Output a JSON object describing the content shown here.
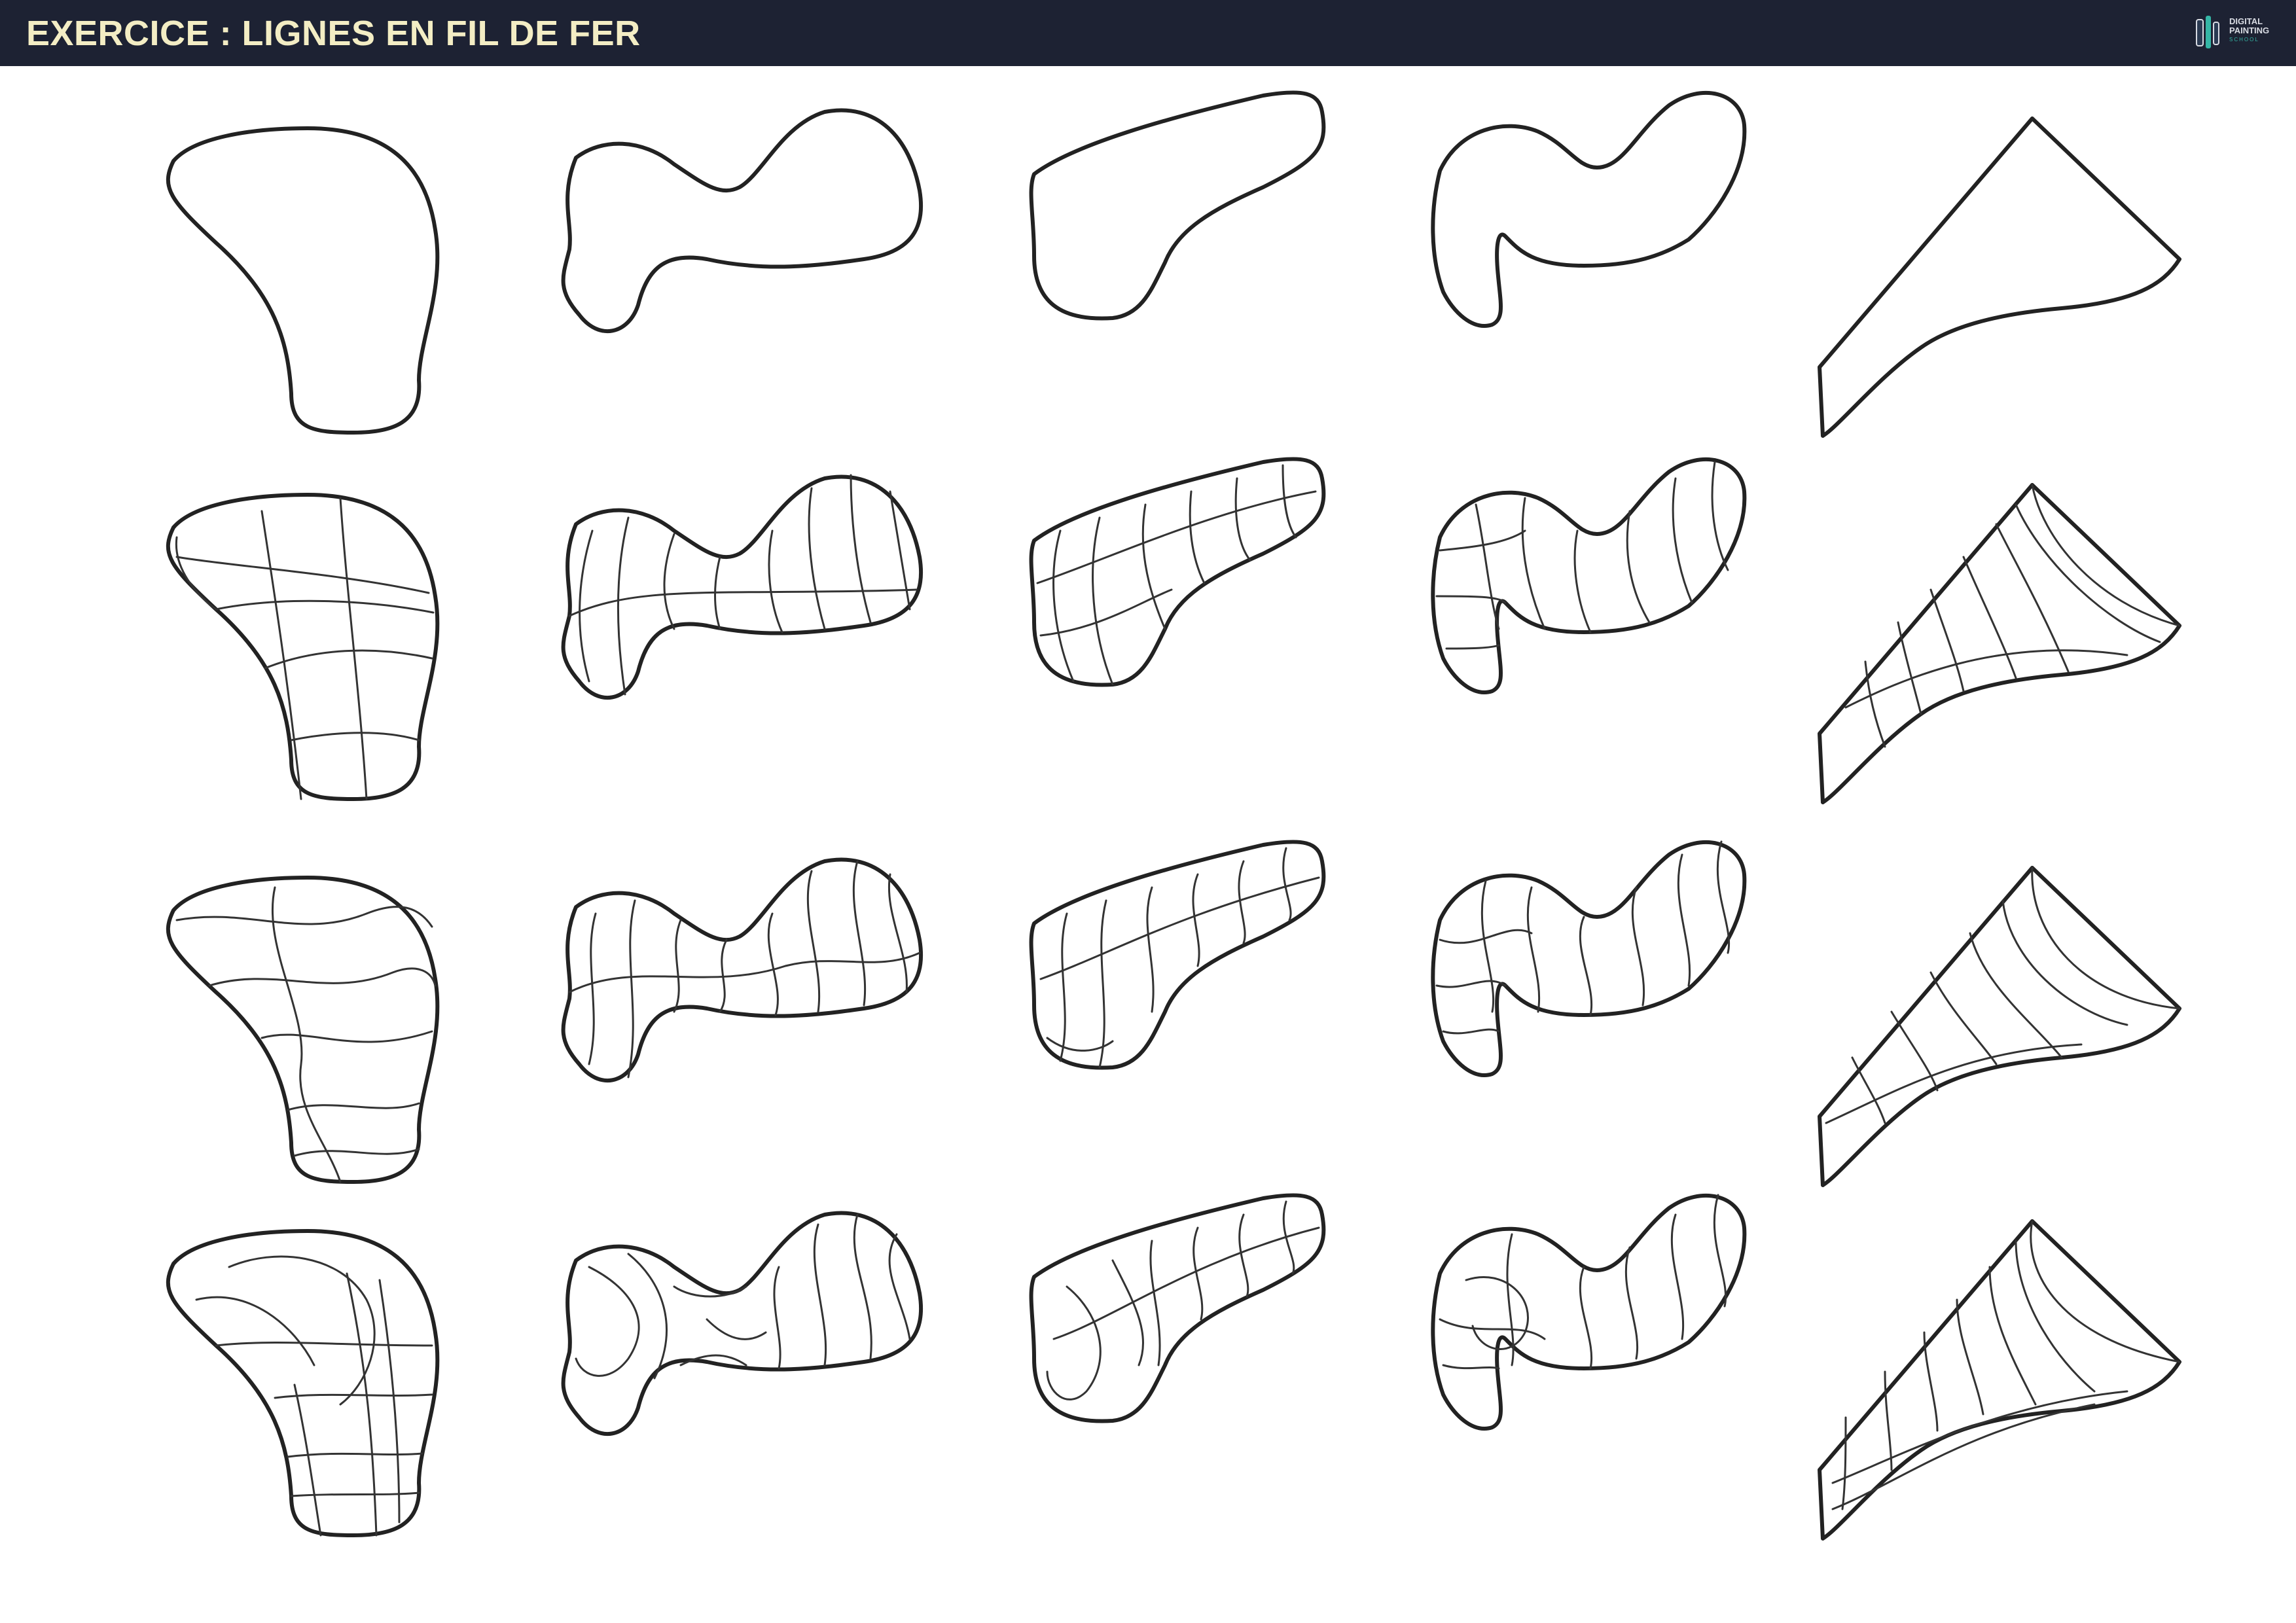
{
  "header": {
    "title": "EXERCICE : LIGNES EN FIL DE FER",
    "background": "#1d2233",
    "title_color": "#f3edc4"
  },
  "logo": {
    "line1": "DIGITAL",
    "line2": "PAINTING",
    "line3": "SCHOOL",
    "accent": "#35b6a6"
  },
  "worksheet": {
    "rows": 4,
    "columns": 5,
    "shape_names": [
      "shape-1",
      "shape-2",
      "shape-3",
      "shape-4",
      "shape-5"
    ]
  }
}
